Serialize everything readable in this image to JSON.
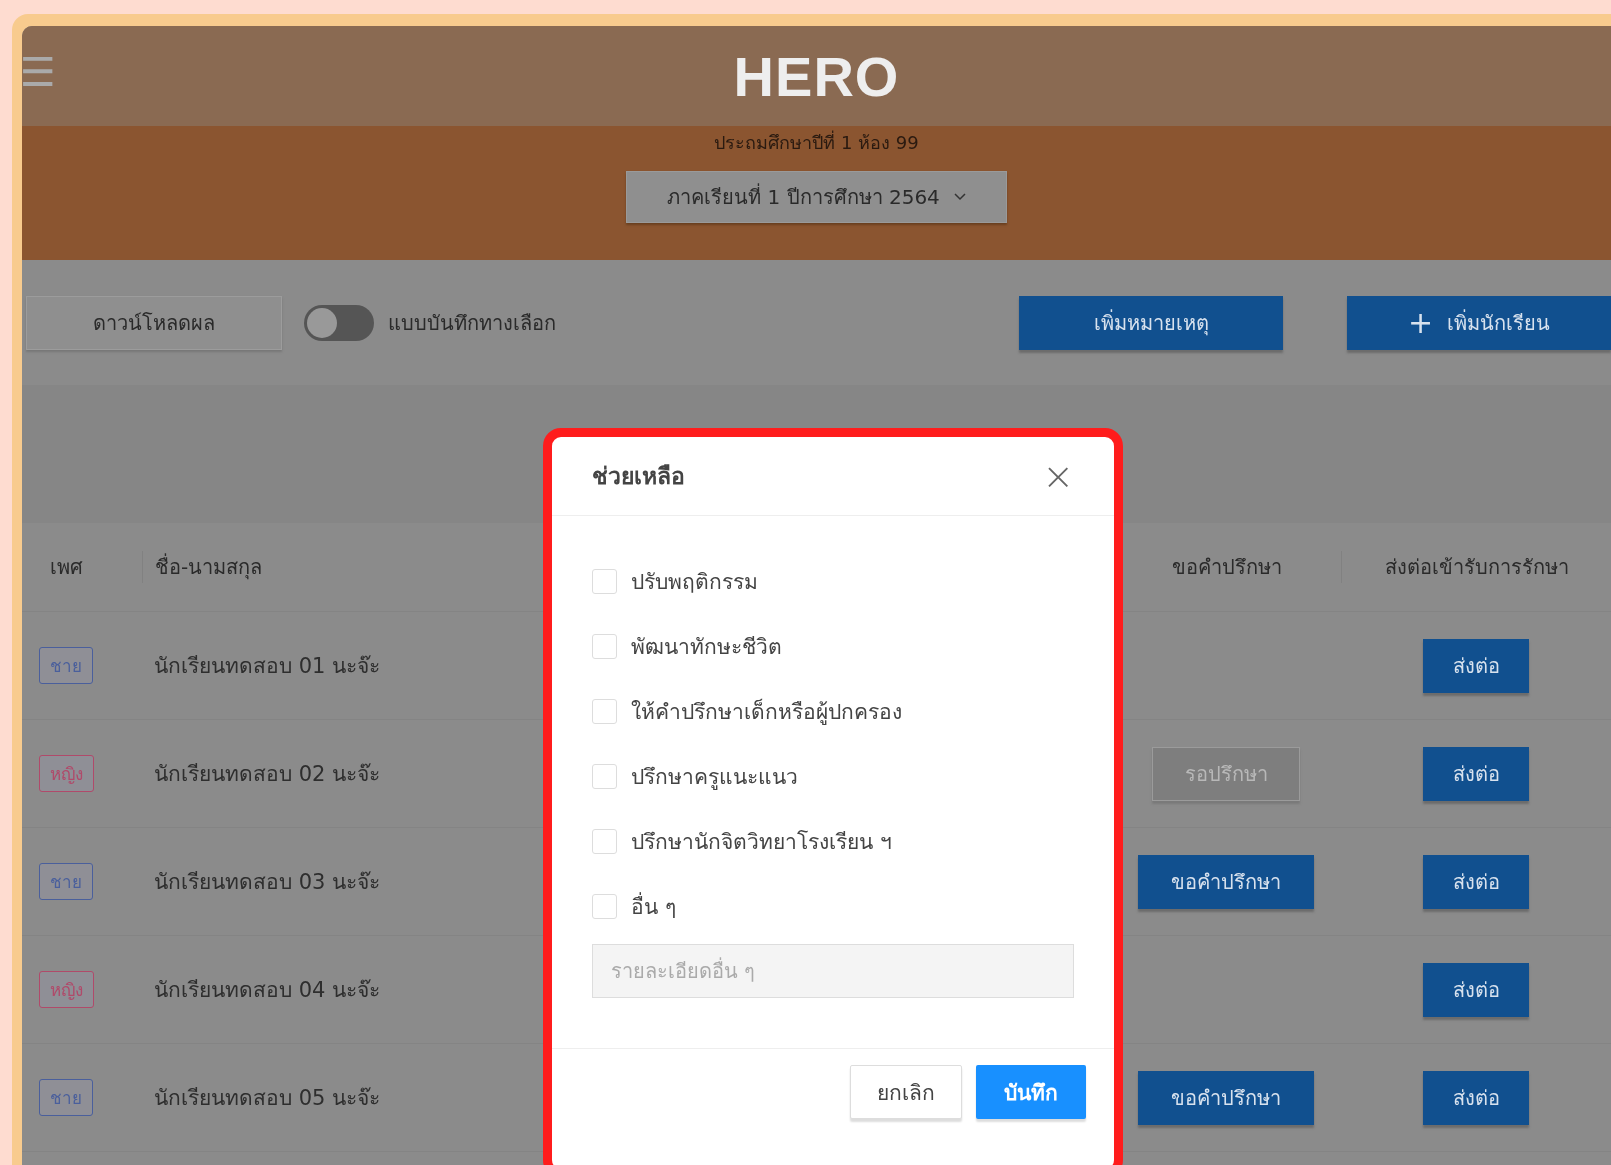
{
  "header": {
    "menu_icon": "☰",
    "logo": "HERO",
    "subtitle": "ประถมศึกษาปีที่ 1 ห้อง 99",
    "term_select": "ภาคเรียนที่ 1 ปีการศึกษา 2564"
  },
  "toolbar": {
    "download_button": "ดาวน์โหลดผล",
    "toggle": {
      "label": "แบบบันทึกทางเลือก",
      "on": false
    },
    "note_button": "เพิ่มหมายเหตุ",
    "add_student_button": {
      "icon": "+",
      "label": "เพิ่มนักเรียน"
    }
  },
  "table": {
    "columns": [
      "เพศ",
      "ชื่อ-นามสกุล",
      "ขอคำปรึกษา",
      "ส่งต่อเข้ารับการรักษา"
    ],
    "rows": [
      {
        "gender": "ชาย",
        "color": "#4a5f9c",
        "name": "นักเรียนทดสอบ 01 นะจ๊ะ",
        "consult": {
          "kind": "none"
        },
        "refer": "ส่งต่อ"
      },
      {
        "gender": "หญิง",
        "color": "#b04a6a",
        "name": "นักเรียนทดสอบ 02 นะจ๊ะ",
        "consult": {
          "kind": "pending",
          "label": "รอปรึกษา"
        },
        "refer": "ส่งต่อ"
      },
      {
        "gender": "ชาย",
        "color": "#4a5f9c",
        "name": "นักเรียนทดสอบ 03 นะจ๊ะ",
        "consult": {
          "kind": "button",
          "label": "ขอคำปรึกษา"
        },
        "refer": "ส่งต่อ"
      },
      {
        "gender": "หญิง",
        "color": "#b04a6a",
        "name": "นักเรียนทดสอบ 04 นะจ๊ะ",
        "consult": {
          "kind": "none"
        },
        "refer": "ส่งต่อ"
      },
      {
        "gender": "ชาย",
        "color": "#4a5f9c",
        "name": "นักเรียนทดสอบ 05 นะจ๊ะ",
        "consult": {
          "kind": "button",
          "label": "ขอคำปรึกษา"
        },
        "refer": "ส่งต่อ"
      }
    ]
  },
  "dialog": {
    "title": "ช่วยเหลือ",
    "close_icon": "×",
    "options": [
      {
        "label": "ปรับพฤติกรรม",
        "checked": false
      },
      {
        "label": "พัฒนาทักษะชีวิต",
        "checked": false
      },
      {
        "label": "ให้คำปรึกษาเด็กหรือผู้ปกครอง",
        "checked": false
      },
      {
        "label": "ปรึกษาครูแนะแนว",
        "checked": false
      },
      {
        "label": "ปรึกษานักจิตวิทยาโรงเรียน ฯ",
        "checked": false
      },
      {
        "label": "อื่น ๆ",
        "checked": false
      }
    ],
    "detail_field": {
      "placeholder": "รายละเอียดอื่น ๆ"
    },
    "buttons": [
      {
        "label": "ยกเลิก",
        "kind": "secondary"
      },
      {
        "label": "บันทึก",
        "kind": "primary"
      }
    ]
  }
}
